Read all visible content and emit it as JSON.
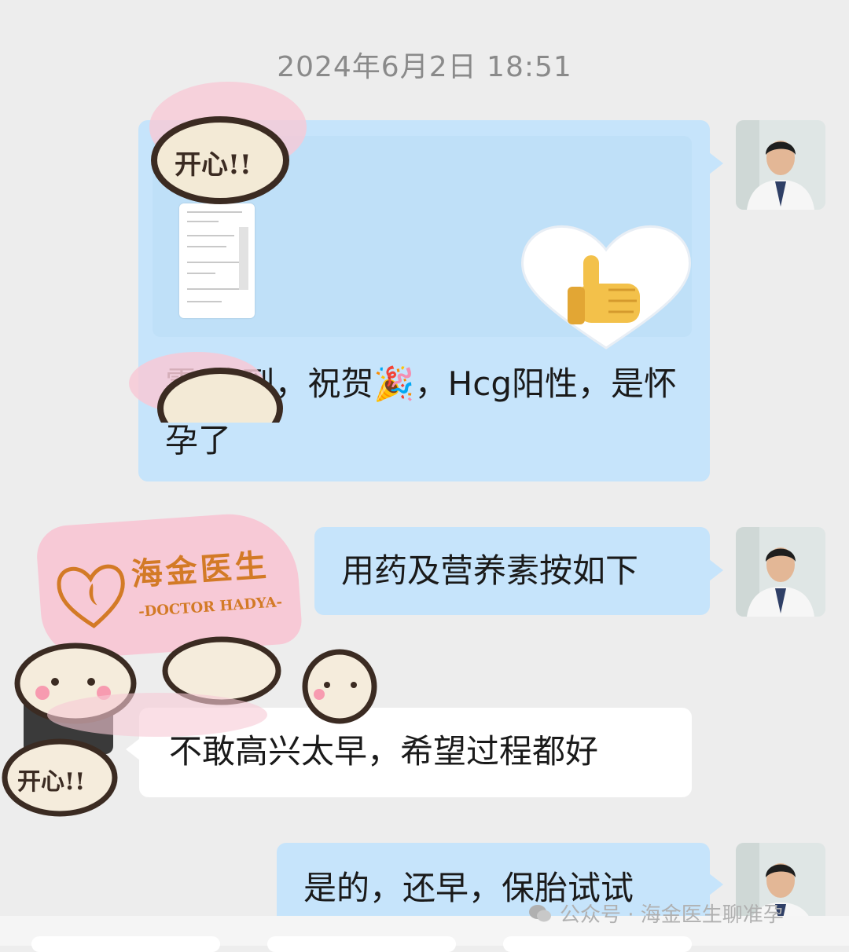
{
  "chat": {
    "timestamp": "2024年6月2日  18:51",
    "messages": [
      {
        "side": "right",
        "sender": "doctor",
        "quote_sticker": "thumbs-up-heart",
        "text": "零 收到，祝贺🎉，Hcg阳性，是怀孕了"
      },
      {
        "side": "right",
        "sender": "doctor",
        "text": "用药及营养素按如下"
      },
      {
        "side": "left",
        "sender": "patient",
        "text": "不敢高兴太早，希望过程都好"
      },
      {
        "side": "right",
        "sender": "doctor",
        "text": "是的，还早，保胎试试"
      }
    ]
  },
  "stickers": {
    "happy_label": "开心!!",
    "logo_title": "海金医生",
    "logo_subtitle": "-DOCTOR HADYA-"
  },
  "watermark": {
    "icon": "wechat-icon",
    "text": "公众号 · 海金医生聊准孕"
  },
  "colors": {
    "background": "#ededed",
    "my_bubble": "#c6e4fb",
    "other_bubble": "#ffffff",
    "timestamp_text": "#8a8a8a",
    "sticker_pink": "#f7c9d6",
    "logo_orange": "#d37a26"
  }
}
